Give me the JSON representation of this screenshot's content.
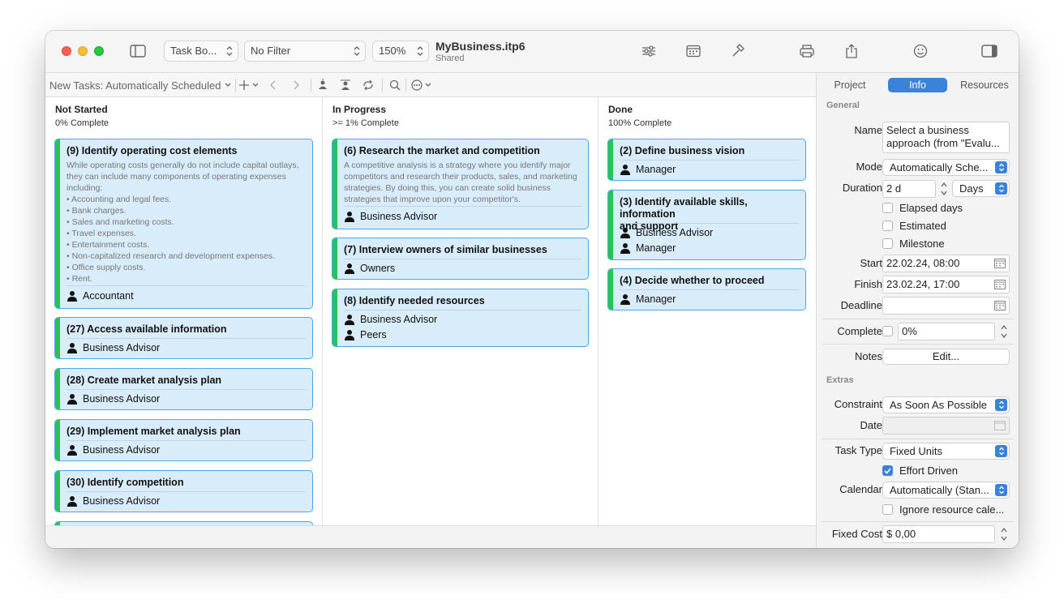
{
  "window": {
    "doc_title": "MyBusiness.itp6",
    "doc_subtitle": "Shared",
    "view_popup": "Task Bo...",
    "filter_popup": "No Filter",
    "zoom_popup": "150%"
  },
  "toolbar2": {
    "new_tasks": "New Tasks: Automatically Scheduled"
  },
  "columns": [
    {
      "title": "Not Started",
      "subtitle": "0% Complete"
    },
    {
      "title": "In Progress",
      "subtitle": ">= 1% Complete"
    },
    {
      "title": "Done",
      "subtitle": "100% Complete"
    }
  ],
  "cards": {
    "c9": {
      "title": "(9) Identify operating cost elements",
      "desc": [
        "While operating costs generally do not include capital outlays,",
        "they can include many components of operating expenses",
        "including:",
        "• Accounting and legal fees.",
        "• Bank charges.",
        "• Sales and marketing costs.",
        "• Travel expenses.",
        "• Entertainment costs.",
        "• Non-capitalized research and development expenses.",
        "• Office supply costs.",
        "• Rent."
      ],
      "res": [
        "Accountant"
      ]
    },
    "c27": {
      "title": "(27) Access available information",
      "res": [
        "Business Advisor"
      ]
    },
    "c28": {
      "title": "(28) Create market analysis plan",
      "res": [
        "Business Advisor"
      ]
    },
    "c29": {
      "title": "(29) Implement market analysis plan",
      "res": [
        "Business Advisor"
      ]
    },
    "c30": {
      "title": "(30) Identify competition",
      "res": [
        "Business Advisor"
      ]
    },
    "c6": {
      "title": "(6) Research the market and competition",
      "desc": [
        "A competitive analysis is a strategy where you identify major",
        "competitors and research their products, sales, and marketing",
        "strategies. By doing this, you can create solid business",
        "strategies that improve upon your competitor's."
      ],
      "res": [
        "Business Advisor"
      ]
    },
    "c7": {
      "title": "(7) Interview owners of similar businesses",
      "res": [
        "Owners"
      ]
    },
    "c8": {
      "title": "(8) Identify needed resources",
      "res": [
        "Business Advisor",
        "Peers"
      ]
    },
    "c2": {
      "title": "(2) Define business vision",
      "res": [
        "Manager"
      ]
    },
    "c3": {
      "title_l1": "(3) Identify available skills, information",
      "title_l2": "and support",
      "res": [
        "Business Advisor",
        "Manager"
      ]
    },
    "c4": {
      "title": "(4) Decide whether to proceed",
      "res": [
        "Manager"
      ]
    }
  },
  "inspector": {
    "tabs": [
      "Project",
      "Info",
      "Resources"
    ],
    "general": "General",
    "name_label": "Name",
    "name_l1": "Select a business",
    "name_l2": "approach (from \"Evalu...",
    "mode_label": "Mode",
    "mode_value": "Automatically Sche...",
    "duration_label": "Duration",
    "duration_value": "2 d",
    "duration_unit": "Days",
    "elapsed": "Elapsed days",
    "estimated": "Estimated",
    "milestone": "Milestone",
    "start_label": "Start",
    "start_value": "22.02.24, 08:00",
    "finish_label": "Finish",
    "finish_value": "23.02.24, 17:00",
    "deadline_label": "Deadline",
    "complete_label": "Complete",
    "complete_value": "0%",
    "notes_label": "Notes",
    "notes_btn": "Edit...",
    "extras": "Extras",
    "constraint_label": "Constraint",
    "constraint_value": "As Soon As Possible",
    "date_label": "Date",
    "tasktype_label": "Task Type",
    "tasktype_value": "Fixed Units",
    "effort": "Effort Driven",
    "calendar_label": "Calendar",
    "calendar_value": "Automatically (Stan...",
    "ignore": "Ignore resource cale...",
    "fixedcost_label": "Fixed Cost",
    "fixedcost_value": "$ 0,00"
  }
}
